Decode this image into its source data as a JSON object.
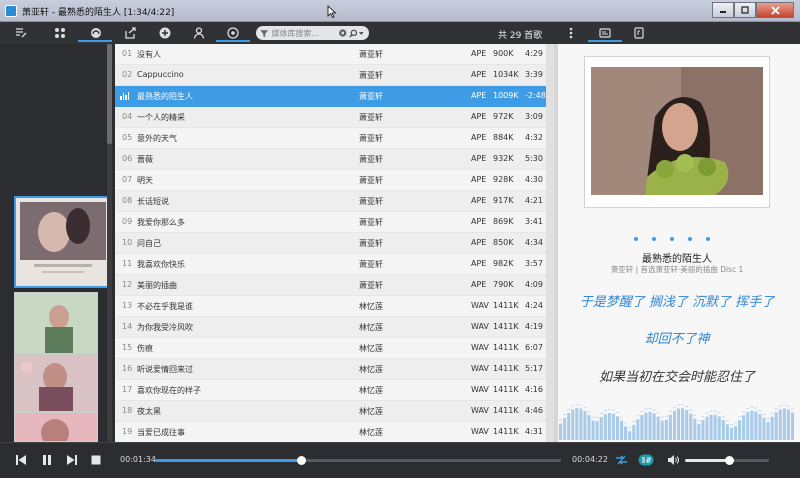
{
  "window": {
    "title": "萧亚轩 - 最熟悉的陌生人 [1:34/4:22]"
  },
  "toolbar": {
    "search_placeholder": "媒体库搜索...",
    "count_label": "共 29 首歌"
  },
  "playlist": [
    {
      "num": "01",
      "title": "没有人",
      "artist": "萧亚轩",
      "format": "APE",
      "size": "900K",
      "duration": "4:29"
    },
    {
      "num": "02",
      "title": "Cappuccino",
      "artist": "萧亚轩",
      "format": "APE",
      "size": "1034K",
      "duration": "3:39"
    },
    {
      "num": "",
      "title": "最熟悉的陌生人",
      "artist": "萧亚轩",
      "format": "APE",
      "size": "1009K",
      "duration": "-2:48",
      "active": true
    },
    {
      "num": "04",
      "title": "一个人的精采",
      "artist": "萧亚轩",
      "format": "APE",
      "size": "972K",
      "duration": "3:09"
    },
    {
      "num": "05",
      "title": "意外的天气",
      "artist": "萧亚轩",
      "format": "APE",
      "size": "884K",
      "duration": "4:32"
    },
    {
      "num": "06",
      "title": "蔷薇",
      "artist": "萧亚轩",
      "format": "APE",
      "size": "932K",
      "duration": "5:30"
    },
    {
      "num": "07",
      "title": "明天",
      "artist": "萧亚轩",
      "format": "APE",
      "size": "928K",
      "duration": "4:30"
    },
    {
      "num": "08",
      "title": "长话短说",
      "artist": "萧亚轩",
      "format": "APE",
      "size": "917K",
      "duration": "4:21"
    },
    {
      "num": "09",
      "title": "我爱你那么多",
      "artist": "萧亚轩",
      "format": "APE",
      "size": "869K",
      "duration": "3:41"
    },
    {
      "num": "10",
      "title": "问自己",
      "artist": "萧亚轩",
      "format": "APE",
      "size": "850K",
      "duration": "4:34"
    },
    {
      "num": "11",
      "title": "我喜欢你快乐",
      "artist": "萧亚轩",
      "format": "APE",
      "size": "982K",
      "duration": "3:57"
    },
    {
      "num": "12",
      "title": "美丽的插曲",
      "artist": "萧亚轩",
      "format": "APE",
      "size": "790K",
      "duration": "4:09"
    },
    {
      "num": "13",
      "title": "不必在乎我是谁",
      "artist": "林忆莲",
      "format": "WAV",
      "size": "1411K",
      "duration": "4:24"
    },
    {
      "num": "14",
      "title": "为你我受冷风吹",
      "artist": "林忆莲",
      "format": "WAV",
      "size": "1411K",
      "duration": "4:19"
    },
    {
      "num": "15",
      "title": "伤痕",
      "artist": "林忆莲",
      "format": "WAV",
      "size": "1411K",
      "duration": "6:07"
    },
    {
      "num": "16",
      "title": "听说爱情回来过",
      "artist": "林忆莲",
      "format": "WAV",
      "size": "1411K",
      "duration": "5:17"
    },
    {
      "num": "17",
      "title": "喜欢你现在的样子",
      "artist": "林忆莲",
      "format": "WAV",
      "size": "1411K",
      "duration": "4:16"
    },
    {
      "num": "18",
      "title": "夜太黑",
      "artist": "林忆莲",
      "format": "WAV",
      "size": "1411K",
      "duration": "4:46"
    },
    {
      "num": "19",
      "title": "当爱已成往事",
      "artist": "林忆莲",
      "format": "WAV",
      "size": "1411K",
      "duration": "4:31"
    }
  ],
  "now_playing": {
    "title": "最熟悉的陌生人",
    "subtitle": "萧亚轩 | 首选萧亚轩·美丽的插曲 Disc 1"
  },
  "lyrics": [
    "于是梦醒了 搁浅了 沉默了 挥手了",
    "却回不了神",
    "如果当初在交会时能忍住了"
  ],
  "player": {
    "elapsed": "00:01:34",
    "total": "00:04:22",
    "progress": 0.36,
    "volume": 0.52
  },
  "colors": {
    "accent": "#3e9be6",
    "toolbar": "#303236",
    "lyric_highlight": "#2f86d6"
  }
}
